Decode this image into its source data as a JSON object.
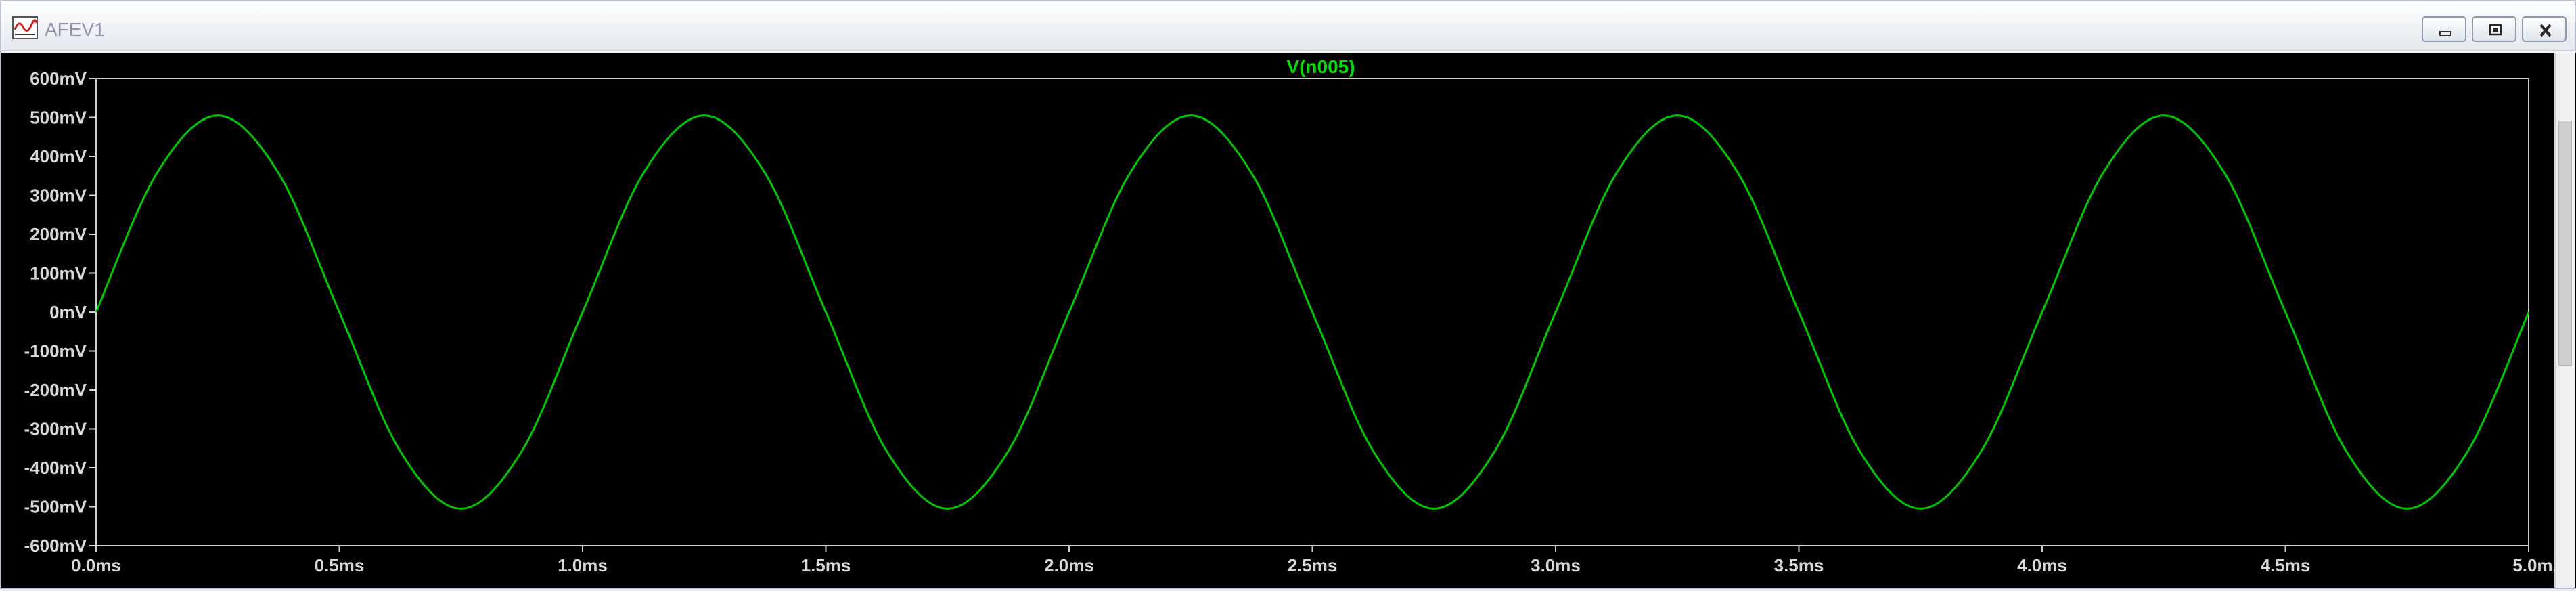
{
  "window": {
    "title": "AFEV1",
    "app_icon": "waveform-chart-icon",
    "controls": [
      "minimize-icon",
      "restore-icon",
      "close-icon"
    ]
  },
  "colors": {
    "trace": "#00c800",
    "title": "#00e000",
    "axis_text": "#d8d8d8",
    "background": "#000000"
  },
  "chart_data": {
    "type": "line",
    "title": "V(n005)",
    "xlabel": "",
    "ylabel": "",
    "xlim": [
      0,
      5.0
    ],
    "ylim": [
      -600,
      600
    ],
    "x_unit": "ms",
    "y_unit": "mV",
    "x_ticks": [
      "0.0ms",
      "0.5ms",
      "1.0ms",
      "1.5ms",
      "2.0ms",
      "2.5ms",
      "3.0ms",
      "3.5ms",
      "4.0ms",
      "4.5ms",
      "5.0ms"
    ],
    "y_ticks": [
      "600mV",
      "500mV",
      "400mV",
      "300mV",
      "200mV",
      "100mV",
      "0mV",
      "-100mV",
      "-200mV",
      "-300mV",
      "-400mV",
      "-500mV",
      "-600mV"
    ],
    "grid": false,
    "series": [
      {
        "name": "V(n005)",
        "x": [
          0.0,
          0.125,
          0.25,
          0.375,
          0.5,
          0.625,
          0.75,
          0.875,
          1.0,
          1.125,
          1.25,
          1.375,
          1.5,
          1.625,
          1.75,
          1.875,
          2.0,
          2.125,
          2.25,
          2.375,
          2.5,
          2.625,
          2.75,
          2.875,
          3.0,
          3.125,
          3.25,
          3.375,
          3.5,
          3.625,
          3.75,
          3.875,
          4.0,
          4.125,
          4.25,
          4.375,
          4.5,
          4.625,
          4.75,
          4.875,
          5.0
        ],
        "y": [
          0,
          357,
          505,
          357,
          0,
          -357,
          -505,
          -357,
          0,
          357,
          505,
          357,
          0,
          -357,
          -505,
          -357,
          0,
          357,
          505,
          357,
          0,
          -357,
          -505,
          -357,
          0,
          357,
          505,
          357,
          0,
          -357,
          -505,
          -357,
          0,
          357,
          505,
          357,
          0,
          -357,
          -505,
          -357,
          0
        ]
      }
    ]
  }
}
